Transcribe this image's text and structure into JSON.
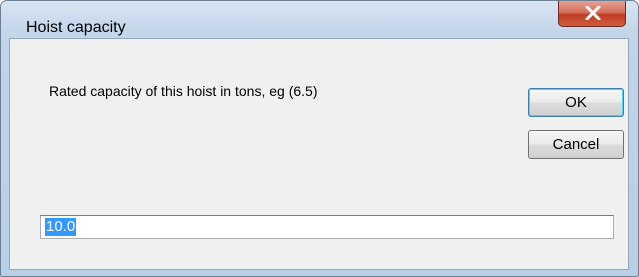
{
  "window": {
    "title": "Hoist capacity"
  },
  "dialog": {
    "prompt": "Rated capacity of this hoist in tons, eg (6.5)",
    "ok_label": "OK",
    "cancel_label": "Cancel",
    "input_value": "10.0"
  },
  "icons": {
    "close": "close-icon"
  },
  "colors": {
    "close_button": "#c13c25",
    "selection": "#3399ff",
    "dialog_bg": "#f0f0f0",
    "frame": "#bfd3e9"
  }
}
